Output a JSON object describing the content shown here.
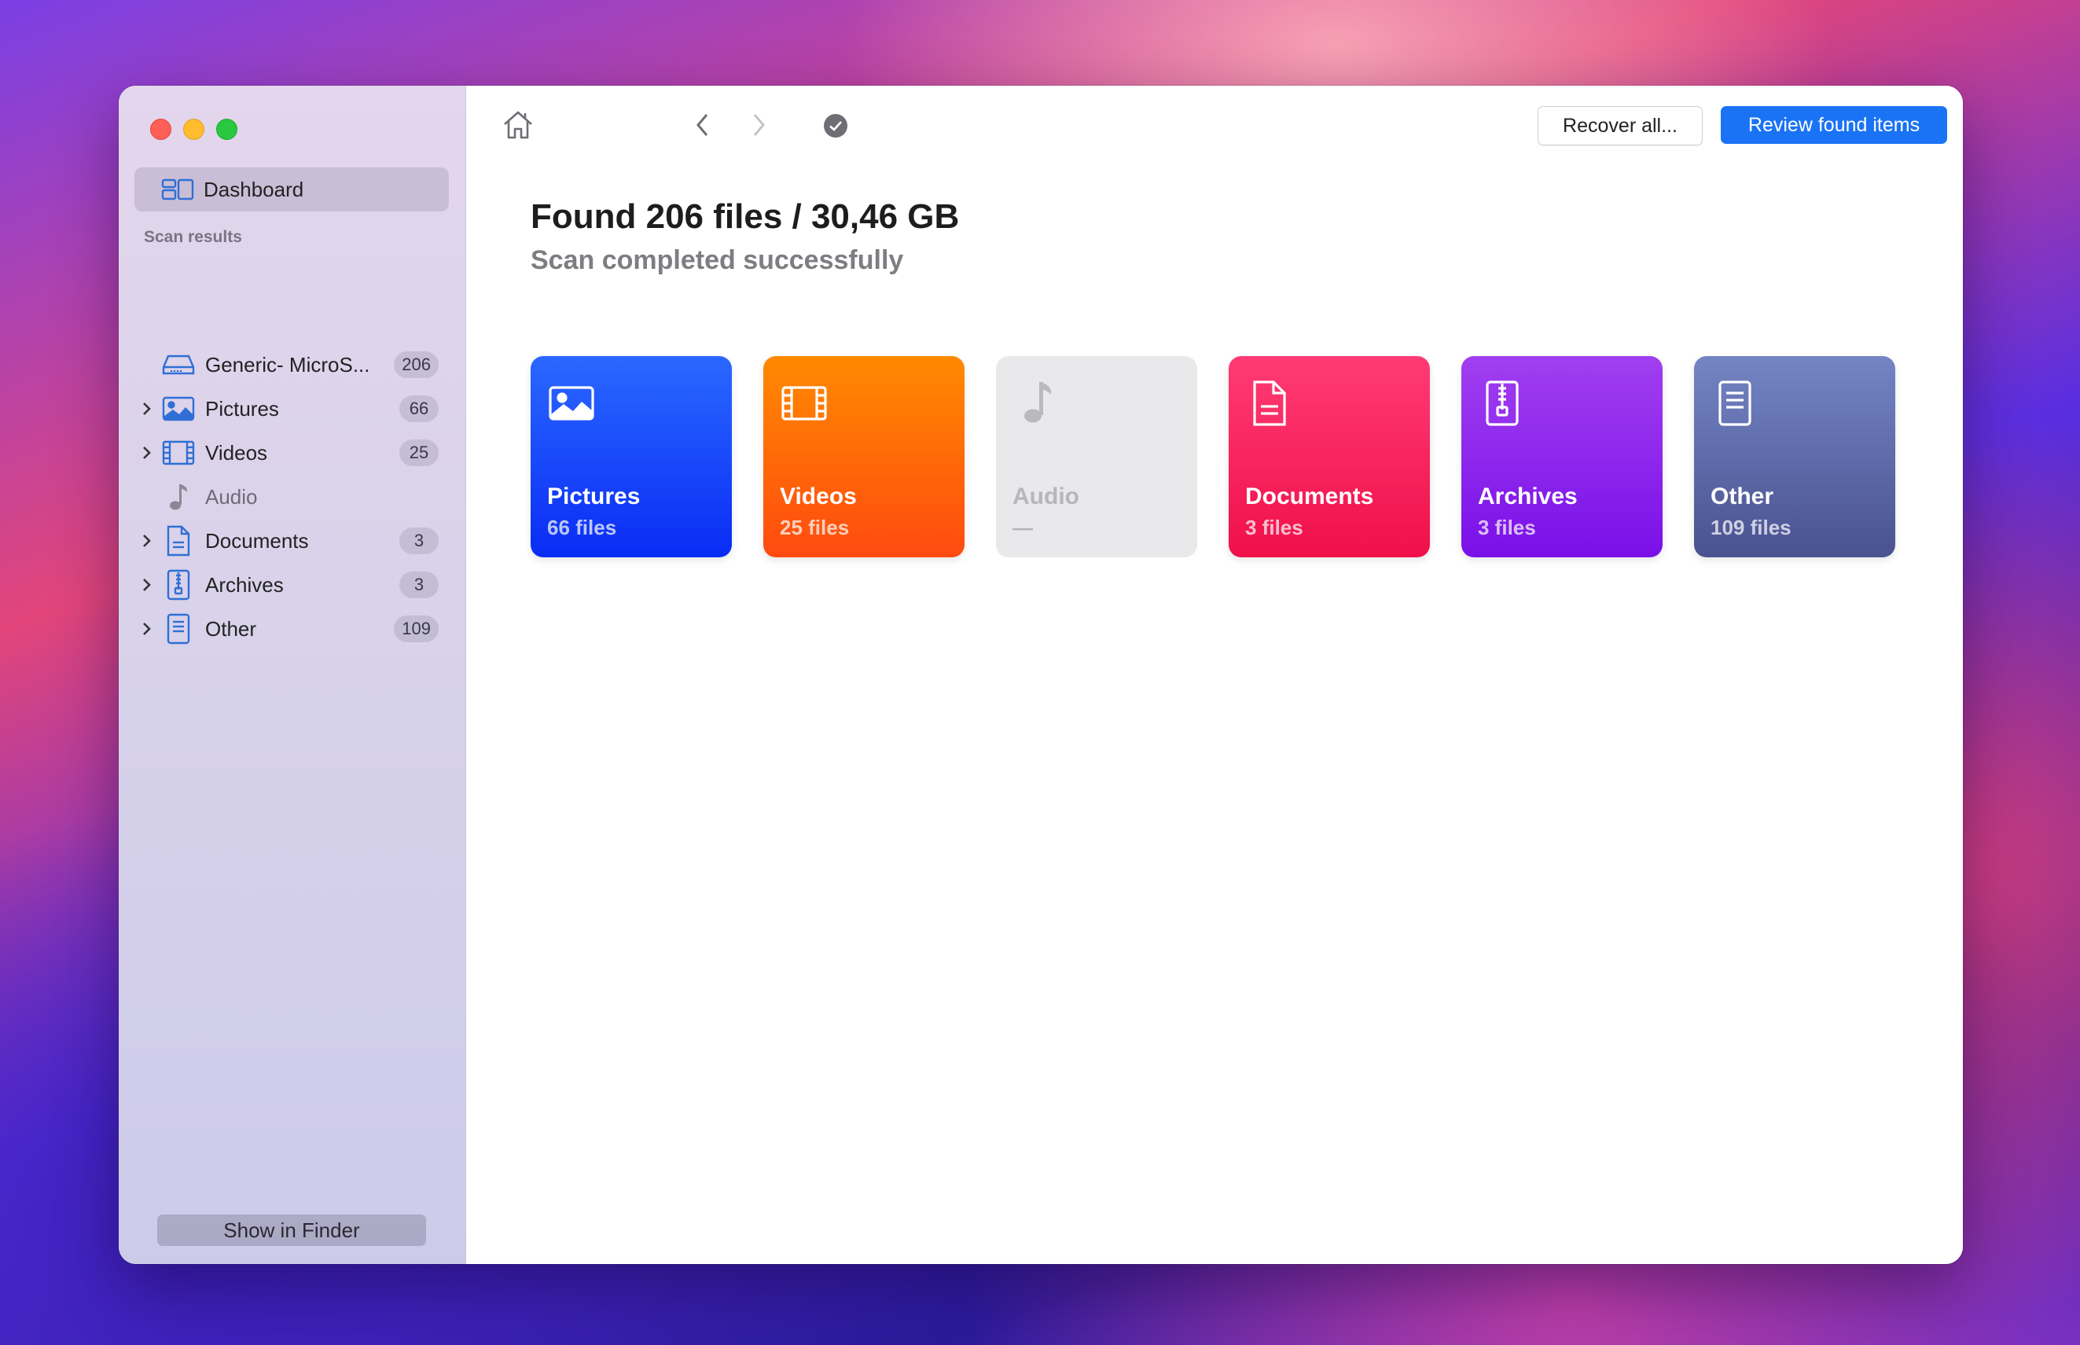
{
  "sidebar": {
    "dashboard_label": "Dashboard",
    "section_title": "Scan results",
    "items": [
      {
        "label": "Generic- MicroS...",
        "count": "206",
        "icon": "drive-icon",
        "expandable": false
      },
      {
        "label": "Pictures",
        "count": "66",
        "icon": "pictures-icon",
        "expandable": true
      },
      {
        "label": "Videos",
        "count": "25",
        "icon": "film-icon",
        "expandable": true
      },
      {
        "label": "Audio",
        "count": "",
        "icon": "music-note-icon",
        "expandable": false
      },
      {
        "label": "Documents",
        "count": "3",
        "icon": "document-icon",
        "expandable": true
      },
      {
        "label": "Archives",
        "count": "3",
        "icon": "archive-icon",
        "expandable": true
      },
      {
        "label": "Other",
        "count": "109",
        "icon": "other-file-icon",
        "expandable": true
      }
    ],
    "show_in_finder_label": "Show in Finder"
  },
  "toolbar": {
    "home_icon": "home-icon",
    "back_icon": "chevron-left-icon",
    "forward_icon": "chevron-right-icon",
    "status_icon": "checkmark-circle-icon",
    "recover_all_label": "Recover all...",
    "review_label": "Review found items"
  },
  "main": {
    "headline": "Found 206 files / 30,46 GB",
    "subline": "Scan completed successfully",
    "tiles": [
      {
        "name": "Pictures",
        "count": "66 files",
        "icon": "pictures-icon",
        "color": "#1540fa"
      },
      {
        "name": "Videos",
        "count": "25 files",
        "icon": "film-icon",
        "color": "#ff6a08"
      },
      {
        "name": "Audio",
        "count": "—",
        "icon": "music-note-icon",
        "color": "#e9e9eb"
      },
      {
        "name": "Documents",
        "count": "3 files",
        "icon": "document-icon",
        "color": "#f5245e"
      },
      {
        "name": "Archives",
        "count": "3 files",
        "icon": "archive-icon",
        "color": "#8c25ec"
      },
      {
        "name": "Other",
        "count": "109 files",
        "icon": "other-file-icon",
        "color": "#5c68a8"
      }
    ]
  },
  "colors": {
    "accent": "#1a73f5",
    "sidebar_icon": "#2f6fd6"
  }
}
